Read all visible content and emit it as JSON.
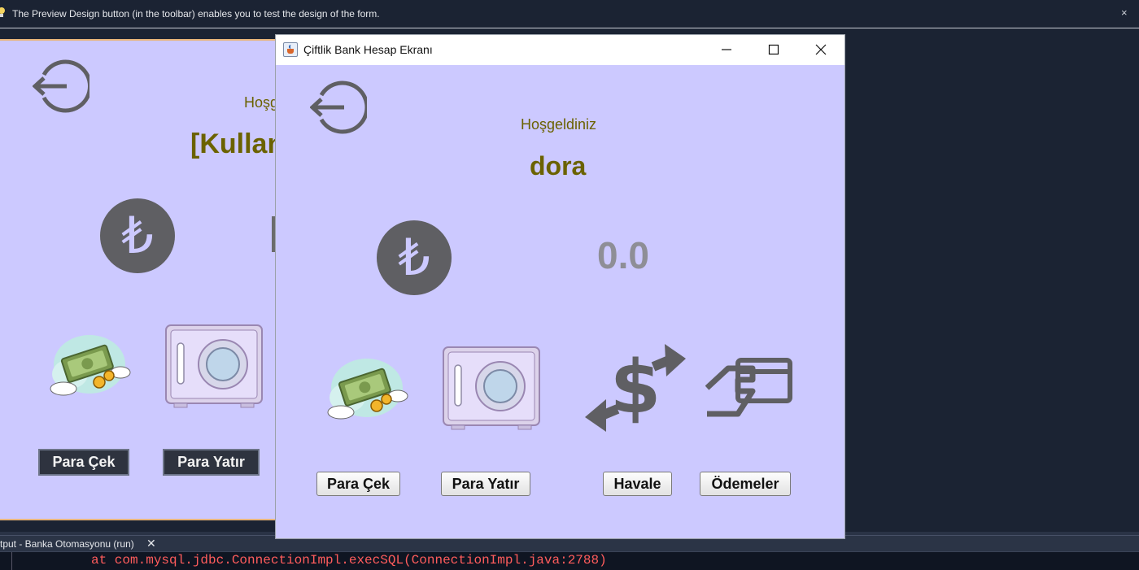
{
  "ide": {
    "hint": "The Preview Design button (in the toolbar) enables you to test the design of the form.",
    "hint_close": "×",
    "output_tab": "tput - Banka Otomasyonu (run)",
    "output_tab_close": "✕",
    "console_line": "at com.mysql.jdbc.ConnectionImpl.execSQL(ConnectionImpl.java:2788)"
  },
  "design_form": {
    "welcome": "Hoşg",
    "username": "[Kullan",
    "withdraw_label": "Para Çek",
    "deposit_label": "Para Yatır"
  },
  "window": {
    "title": "Çiftlik Bank Hesap Ekranı",
    "welcome": "Hoşgeldiniz",
    "username": "dora",
    "currency_symbol": "₺",
    "balance": "0.0",
    "buttons": {
      "withdraw": "Para Çek",
      "deposit": "Para Yatır",
      "transfer": "Havale",
      "payments": "Ödemeler"
    }
  },
  "icons": [
    "logout-icon",
    "lira-icon",
    "money-cloud-icon",
    "safe-icon",
    "dollar-transfer-icon",
    "card-payment-icon",
    "minimize-icon",
    "maximize-icon",
    "close-icon",
    "java-app-icon",
    "lightbulb-icon"
  ],
  "colors": {
    "form_bg": "#ccc9ff",
    "accent_olive": "#6b6200",
    "balance_gray": "#8e8e96",
    "icon_gray": "#5f5f63",
    "ide_bg": "#1b2333"
  }
}
